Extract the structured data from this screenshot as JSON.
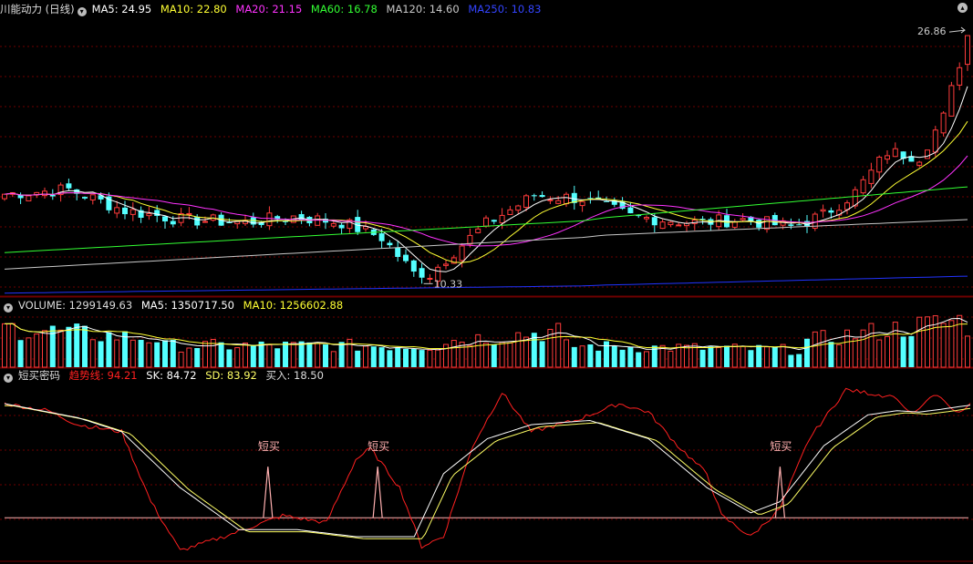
{
  "colors": {
    "up": "#ff3b3b",
    "down": "#54ffff",
    "ma5": "#ffffff",
    "ma10": "#ffff33",
    "ma20": "#ff33ff",
    "ma60": "#33ff33",
    "ma120": "#c8c8c8",
    "ma250": "#2233ff",
    "grid": "#6e0000",
    "trend": "#ff2020",
    "sk": "#ffffff",
    "sd": "#ffff66",
    "buy": "#ffb0b0"
  },
  "price_panel": {
    "title": "川能动力 (日线)",
    "ma5_label": "MA5: 24.95",
    "ma10_label": "MA10: 22.80",
    "ma20_label": "MA20: 21.15",
    "ma60_label": "MA60: 16.78",
    "ma120_label": "MA120: 14.60",
    "ma250_label": "MA250: 10.83",
    "high_label": "26.86",
    "low_label": "10.33"
  },
  "volume_panel": {
    "volume_label": "VOLUME: 1299149.63",
    "ma5_label": "MA5: 1350717.50",
    "ma10_label": "MA10: 1256602.88"
  },
  "indicator_panel": {
    "name": "短买密码",
    "trend_label": "趋势线: 94.21",
    "sk_label": "SK: 84.72",
    "sd_label": "SD: 83.92",
    "buy_label": "买入: 18.50",
    "signal_text": "短买"
  },
  "chart_data": [
    {
      "type": "candlestick",
      "title": "川能动力 (日线)",
      "ylim": [
        9.5,
        28.2
      ],
      "days": 120,
      "close_keypoints": [
        [
          0,
          16.3
        ],
        [
          8,
          16.6
        ],
        [
          15,
          15.2
        ],
        [
          22,
          14.6
        ],
        [
          30,
          14.4
        ],
        [
          36,
          14.8
        ],
        [
          42,
          14.4
        ],
        [
          47,
          13.4
        ],
        [
          52,
          10.4
        ],
        [
          55,
          12.0
        ],
        [
          60,
          14.3
        ],
        [
          66,
          16.2
        ],
        [
          72,
          16.0
        ],
        [
          78,
          14.8
        ],
        [
          86,
          14.4
        ],
        [
          92,
          14.6
        ],
        [
          98,
          14.1
        ],
        [
          102,
          14.9
        ],
        [
          106,
          16.4
        ],
        [
          110,
          19.1
        ],
        [
          114,
          18.8
        ],
        [
          117,
          21.4
        ],
        [
          120,
          26.86
        ]
      ],
      "marked_low": {
        "day": 52,
        "value": 10.33
      },
      "marked_high": {
        "day": 120,
        "value": 26.86
      },
      "ma_last": {
        "MA5": 24.95,
        "MA10": 22.8,
        "MA20": 21.15,
        "MA60": 16.78,
        "MA120": 14.6,
        "MA250": 10.83
      }
    },
    {
      "type": "bar",
      "title": "VOLUME",
      "ylim": [
        0,
        2400000
      ],
      "last": {
        "VOLUME": 1299149.63,
        "MA5": 1350717.5,
        "MA10": 1256602.88
      }
    },
    {
      "type": "line",
      "title": "短买密码",
      "ylim": [
        -10,
        115
      ],
      "trend_keypoints": [
        [
          0,
          100
        ],
        [
          6,
          95
        ],
        [
          10,
          85
        ],
        [
          16,
          80
        ],
        [
          20,
          30
        ],
        [
          24,
          -5
        ],
        [
          30,
          5
        ],
        [
          38,
          20
        ],
        [
          44,
          15
        ],
        [
          48,
          60
        ],
        [
          50,
          68
        ],
        [
          54,
          40
        ],
        [
          57,
          -2
        ],
        [
          60,
          5
        ],
        [
          64,
          70
        ],
        [
          68,
          108
        ],
        [
          72,
          80
        ],
        [
          78,
          88
        ],
        [
          84,
          100
        ],
        [
          88,
          94
        ],
        [
          92,
          70
        ],
        [
          96,
          50
        ],
        [
          98,
          20
        ],
        [
          102,
          5
        ],
        [
          106,
          25
        ],
        [
          110,
          75
        ],
        [
          115,
          110
        ],
        [
          120,
          106
        ]
      ],
      "sk_keypoints": [
        [
          0,
          100
        ],
        [
          10,
          90
        ],
        [
          16,
          80
        ],
        [
          24,
          40
        ],
        [
          32,
          10
        ],
        [
          40,
          10
        ],
        [
          48,
          5
        ],
        [
          56,
          5
        ],
        [
          60,
          50
        ],
        [
          66,
          75
        ],
        [
          72,
          85
        ],
        [
          80,
          88
        ],
        [
          88,
          75
        ],
        [
          96,
          40
        ],
        [
          102,
          22
        ],
        [
          106,
          30
        ],
        [
          112,
          70
        ],
        [
          118,
          92
        ],
        [
          122,
          95
        ],
        [
          125,
          94
        ],
        [
          128,
          96
        ],
        [
          132,
          99
        ]
      ],
      "buy_signals": [
        {
          "day": 36,
          "value": 18.5
        },
        {
          "day": 51,
          "value": 18.5
        },
        {
          "day": 106,
          "value": 18.5
        }
      ],
      "baseline": 18.5,
      "last": {
        "趋势线": 94.21,
        "SK": 84.72,
        "SD": 83.92,
        "买入": 18.5
      }
    }
  ]
}
